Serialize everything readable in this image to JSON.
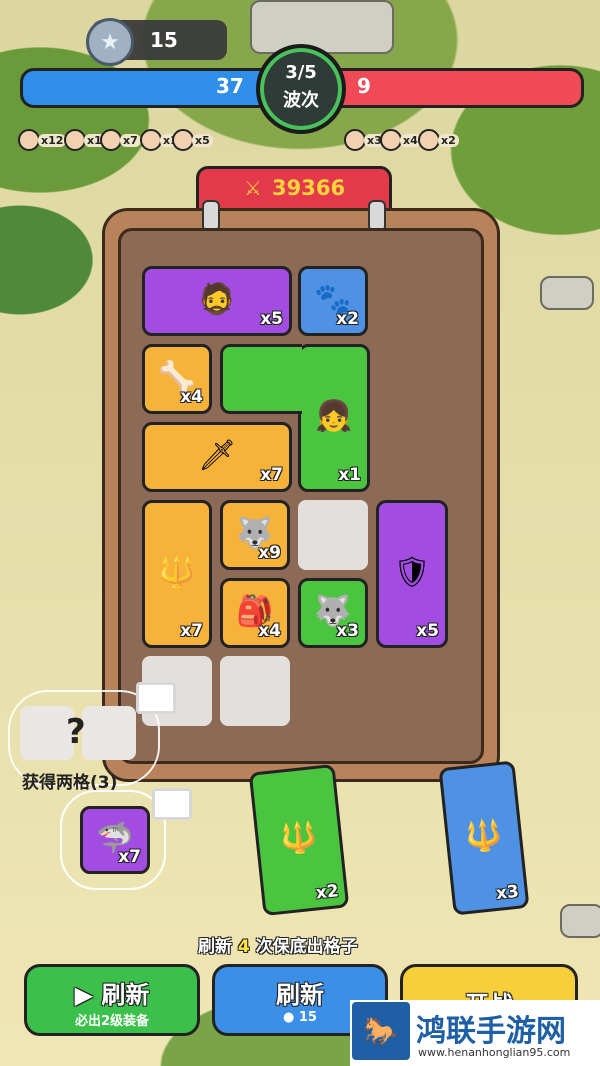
{
  "hud": {
    "coins": "15",
    "player_hp": "37",
    "enemy_hp": "9",
    "wave": "3/5",
    "wave_label": "波次",
    "power_icon": "crossed-swords-icon",
    "power": "39366",
    "player_units": [
      "x12",
      "x12",
      "x7",
      "x1",
      "x5"
    ],
    "enemy_units": [
      "x3",
      "x4",
      "x2"
    ]
  },
  "board": {
    "tiles": [
      {
        "name": "caveman-tile",
        "color": "purple",
        "count": "x5"
      },
      {
        "name": "blue-creature-tile",
        "color": "blue",
        "count": "x2"
      },
      {
        "name": "bone-necklace-tile",
        "color": "orange",
        "count": "x4"
      },
      {
        "name": "spear-girl-tile",
        "color": "green",
        "count": "x1"
      },
      {
        "name": "caveman-knife-tile",
        "color": "orange",
        "count": "x7"
      },
      {
        "name": "spear-warrior-tile",
        "color": "orange",
        "count": "x7"
      },
      {
        "name": "wolf-tile",
        "color": "orange",
        "count": "x9"
      },
      {
        "name": "shield-wolf-girl-tile",
        "color": "purple",
        "count": "x5"
      },
      {
        "name": "red-bag-tile",
        "color": "orange",
        "count": "x4"
      },
      {
        "name": "green-wolf-tile",
        "color": "green",
        "count": "x3"
      }
    ]
  },
  "offers": {
    "get_two_label": "获得两格(3)",
    "question": "?",
    "shark_count": "x7",
    "warrior_green_count": "x2",
    "warrior_blue_count": "x3"
  },
  "footer": {
    "tip_prefix": "刷新",
    "tip_number": "4",
    "tip_suffix": "次保底出格子",
    "refresh_video_label": "刷新",
    "refresh_video_sub": "必出2级装备",
    "refresh_coin_label": "刷新",
    "refresh_coin_cost": "15",
    "start_label": "开战"
  },
  "watermark": {
    "title": "鸿联手游网",
    "url": "www.henanhonglian95.com"
  },
  "colors": {
    "blue_bar": "#2f8fe8",
    "red_bar": "#f04a57",
    "purple_tile": "#a24ce1",
    "orange_tile": "#f7b23a",
    "green_tile": "#4bc440",
    "blue_tile": "#4f91e2"
  }
}
